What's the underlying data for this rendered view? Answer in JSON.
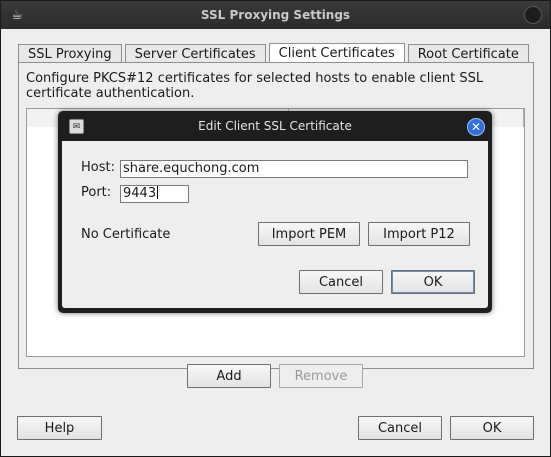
{
  "window": {
    "title": "SSL Proxying Settings"
  },
  "tabs": [
    {
      "label": "SSL Proxying"
    },
    {
      "label": "Server Certificates"
    },
    {
      "label": "Client Certificates"
    },
    {
      "label": "Root Certificate"
    }
  ],
  "active_tab": "Client Certificates",
  "panel": {
    "description": "Configure PKCS#12 certificates for selected hosts to enable client SSL certificate authentication.",
    "add_label": "Add",
    "remove_label": "Remove"
  },
  "footer": {
    "help_label": "Help",
    "cancel_label": "Cancel",
    "ok_label": "OK"
  },
  "dialog": {
    "title": "Edit Client SSL Certificate",
    "host_label": "Host:",
    "host_value": "share.equchong.com",
    "port_label": "Port:",
    "port_value": "9443",
    "status_text": "No Certificate",
    "import_pem_label": "Import PEM",
    "import_p12_label": "Import P12",
    "cancel_label": "Cancel",
    "ok_label": "OK"
  },
  "colors": {
    "titlebar": "#2b2b2b",
    "window_bg": "#eeeeee",
    "close_accent": "#2f6fdc"
  }
}
